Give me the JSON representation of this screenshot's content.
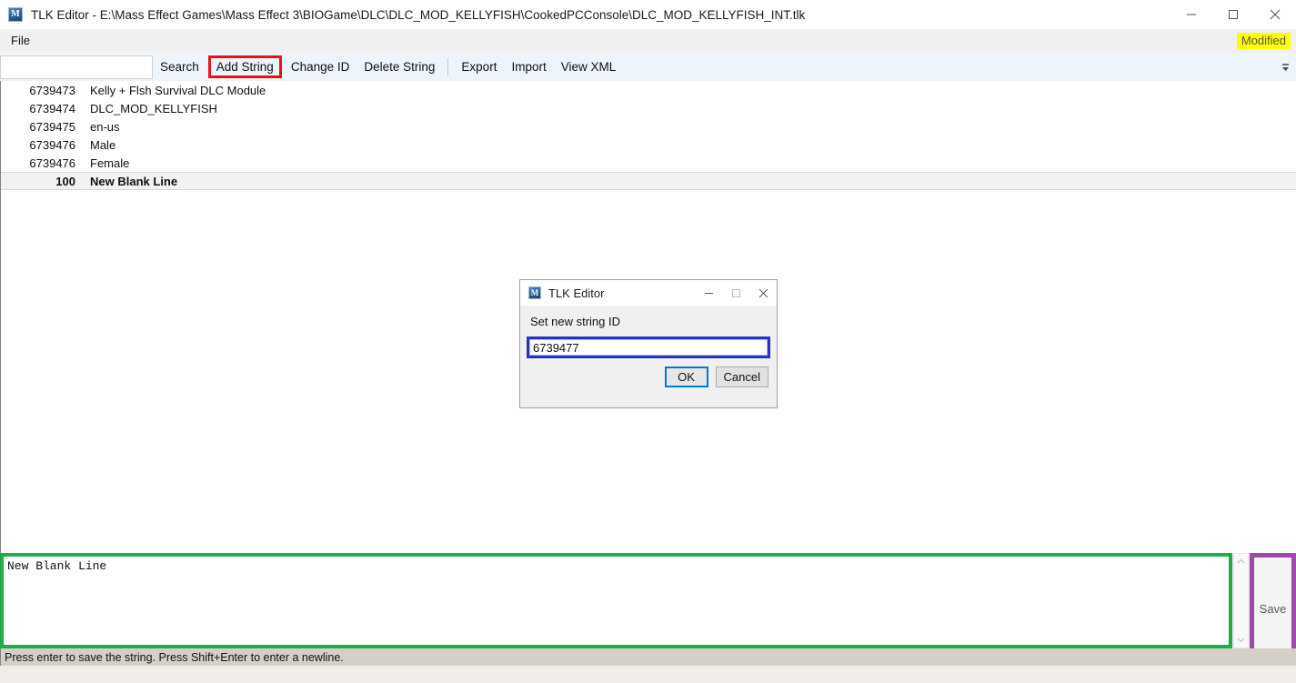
{
  "window": {
    "title": "TLK Editor - E:\\Mass Effect Games\\Mass Effect 3\\BIOGame\\DLC\\DLC_MOD_KELLYFISH\\CookedPCConsole\\DLC_MOD_KELLYFISH_INT.tlk",
    "icon": "app-icon-m",
    "minimize": "minimize-icon",
    "maximize": "maximize-icon",
    "close": "close-icon"
  },
  "menubar": {
    "items": [
      {
        "label": "File"
      }
    ],
    "status_badge": {
      "label": "Modified",
      "background": "#ffff00",
      "color": "#555555"
    }
  },
  "toolbar": {
    "search_value": "",
    "search_placeholder": "",
    "buttons": [
      {
        "label": "Search",
        "name": "search-button",
        "highlighted": false
      },
      {
        "label": "Add String",
        "name": "add-string-button",
        "highlighted": true
      },
      {
        "label": "Change ID",
        "name": "change-id-button",
        "highlighted": false
      },
      {
        "label": "Delete String",
        "name": "delete-string-button",
        "highlighted": false
      },
      {
        "label": "Export",
        "name": "export-button",
        "highlighted": false
      },
      {
        "label": "Import",
        "name": "import-button",
        "highlighted": false
      },
      {
        "label": "View XML",
        "name": "view-xml-button",
        "highlighted": false
      }
    ],
    "overflow_icon": "chevron-down-icon",
    "highlight_color": "#e8121d"
  },
  "string_list": {
    "rows": [
      {
        "id": "6739473",
        "value": "Kelly + Flsh Survival DLC Module",
        "selected": false
      },
      {
        "id": "6739474",
        "value": "DLC_MOD_KELLYFISH",
        "selected": false
      },
      {
        "id": "6739475",
        "value": "en-us",
        "selected": false
      },
      {
        "id": "6739476",
        "value": "Male",
        "selected": false
      },
      {
        "id": "6739476",
        "value": "Female",
        "selected": false
      },
      {
        "id": "100",
        "value": "New Blank Line",
        "selected": true
      }
    ]
  },
  "editor": {
    "text": "New Blank Line",
    "highlight_color": "#22ab4b",
    "scroll_up_icon": "chevron-up-icon",
    "scroll_down_icon": "chevron-down-icon"
  },
  "save": {
    "label": "Save",
    "highlight_color": "#9b4aa8"
  },
  "statusbar": {
    "text": "Press enter to save the string. Press Shift+Enter to enter a newline."
  },
  "dialog": {
    "title": "TLK Editor",
    "icon": "app-icon-m",
    "minimize": "minimize-icon",
    "maximize": "maximize-icon",
    "close": "close-icon",
    "label": "Set new string ID",
    "input_value": "6739477",
    "input_highlight_color": "#2b2fc4",
    "ok_label": "OK",
    "cancel_label": "Cancel"
  }
}
